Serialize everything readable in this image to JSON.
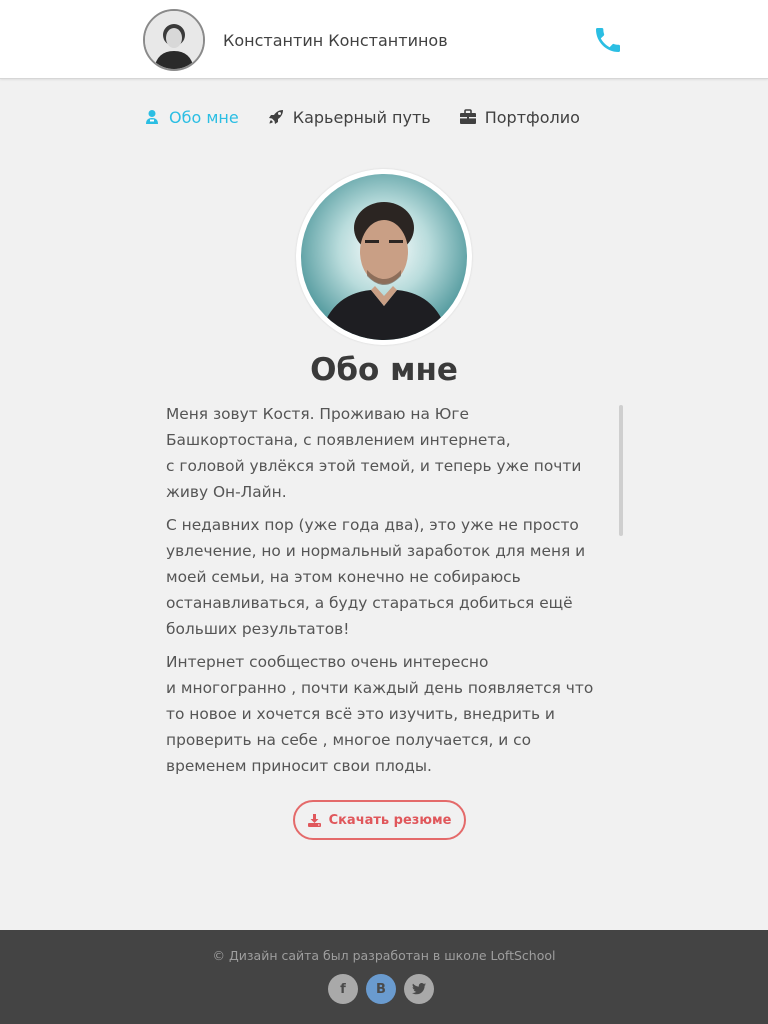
{
  "header": {
    "name": "Константин Константинов",
    "phone_icon": "phone-icon",
    "accent": "#2bbee3"
  },
  "nav": {
    "items": [
      {
        "label": "Обо мне",
        "icon": "user-icon",
        "active": true
      },
      {
        "label": "Карьерный путь",
        "icon": "rocket-icon",
        "active": false
      },
      {
        "label": "Портфолио",
        "icon": "briefcase-icon",
        "active": false
      }
    ]
  },
  "about": {
    "title": "Обо мне",
    "paragraphs": [
      "Меня зовут Костя. Проживаю на Юге\nБашкортостана, с появлением интернета,\nс головой увлёкся этой темой, и теперь уже почти\nживу Он-Лайн.",
      "С недавних пор (уже года два), это уже не просто\nувлечение, но и нормальный заработок для меня и\nмоей семьи, на этом конечно не собираюсь\nостанавливаться, а буду стараться добиться ещё\nбольших результатов!",
      "Интернет сообщество очень интересно\nи многогранно , почти каждый день появляется что\nто новое и хочется всё это изучить, внедрить и\nпроверить на себе , многое получается, и со\nвременем приносит свои плоды."
    ],
    "resume_button": "Скачать резюме",
    "resume_color": "#e0575b"
  },
  "footer": {
    "copyright": "© Дизайн сайта был разработан в школе LoftSchool",
    "socials": [
      {
        "label": "f",
        "icon": "facebook-icon",
        "color": "#a9a9a9"
      },
      {
        "label": "B",
        "icon": "vk-icon",
        "color": "#6a9bcf"
      },
      {
        "label": "",
        "icon": "twitter-icon",
        "color": "#a9a9a9"
      }
    ]
  }
}
